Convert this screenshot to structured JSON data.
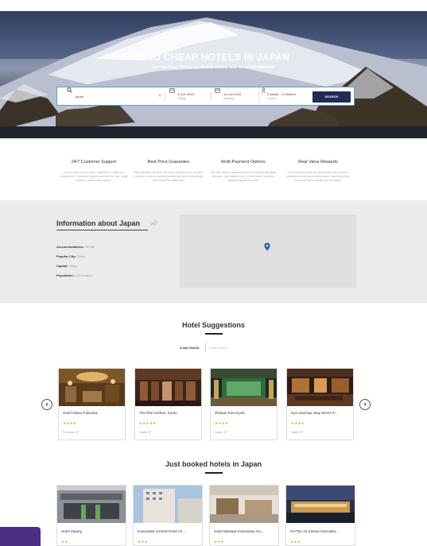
{
  "hero": {
    "title": "FIND CHEAP HOTELS IN JAPAN",
    "subtitle": "Get the Best Prices on 49,566 Hotels and Accommodations"
  },
  "search": {
    "destination": "Japan",
    "checkin_date": "6 Jun 2024",
    "checkin_day": "Friday",
    "checkout_date": "14 Jun 2024",
    "checkout_day": "Saturday",
    "guests": "2 Adults , 0 Children",
    "rooms": "1 room",
    "button": "SEARCH"
  },
  "features": [
    {
      "title": "24/7 Customer Support",
      "text": "Do you need help or have a question? Contact our proactive 24/7 customer support team via live chat, email, hotline or online claim system."
    },
    {
      "title": "Best Price Guarantee",
      "text": "We guarantee we have the lowest hotel prices. If you find a cheaper hotel on another website after you book with us, we'll refund the difference!"
    },
    {
      "title": "Multi-Payment Options",
      "text": "We offer various payment methods including eBanking services, Visa, Master Card, Credit Cards, and other leading Cryptocurrencies."
    },
    {
      "title": "Real Value Rewards",
      "text": "Earn rewards easily and quickly with our exclusive Valentine's travel promotion program including bonus discounts, travel, loyalty and Dumbcoin."
    }
  ],
  "info": {
    "title": "Information about Japan",
    "rows": [
      {
        "label": "Accommodations:",
        "value": "49,566"
      },
      {
        "label": "Popular City:",
        "value": "Tokyo"
      },
      {
        "label": "Capital:",
        "value": "Tokyo"
      },
      {
        "label": "Population:",
        "value": "125.8 million"
      }
    ]
  },
  "suggestions": {
    "title": "Hotel Suggestions",
    "tabs": [
      "5-star Hotels",
      "4-star Hotels"
    ],
    "hotels": [
      {
        "name": "Hotel Okura Fukuoka",
        "stars": "★★★★",
        "location": "Fukuoka, JP"
      },
      {
        "name": "The Ritz-Carlton, Kyoto",
        "stars": "★★★★★",
        "location": "Kyoto, JP"
      },
      {
        "name": "Dhawa Yura Kyoto",
        "stars": "★★★★",
        "location": "Kyoto, JP"
      },
      {
        "name": "Kyo-machiya Stay WAKA F...",
        "stars": "★★★★",
        "location": "Kyoto, JP"
      }
    ]
  },
  "booked": {
    "title": "Just booked hotels in Japan",
    "hotels": [
      {
        "name": "Hotel Zipang",
        "stars": "★★"
      },
      {
        "name": "Kanazawa Central Hotel An...",
        "stars": "★★★"
      },
      {
        "name": "Hotel Mystays Kanazawa Ca...",
        "stars": "★★★"
      },
      {
        "name": "HOTEL GI Kansai Internatio...",
        "stars": "★★★"
      }
    ]
  },
  "colors": {
    "navy": "#1f2d55",
    "star": "#e8a325",
    "chat": "#4b2e83",
    "pin": "#1e5fa8"
  }
}
